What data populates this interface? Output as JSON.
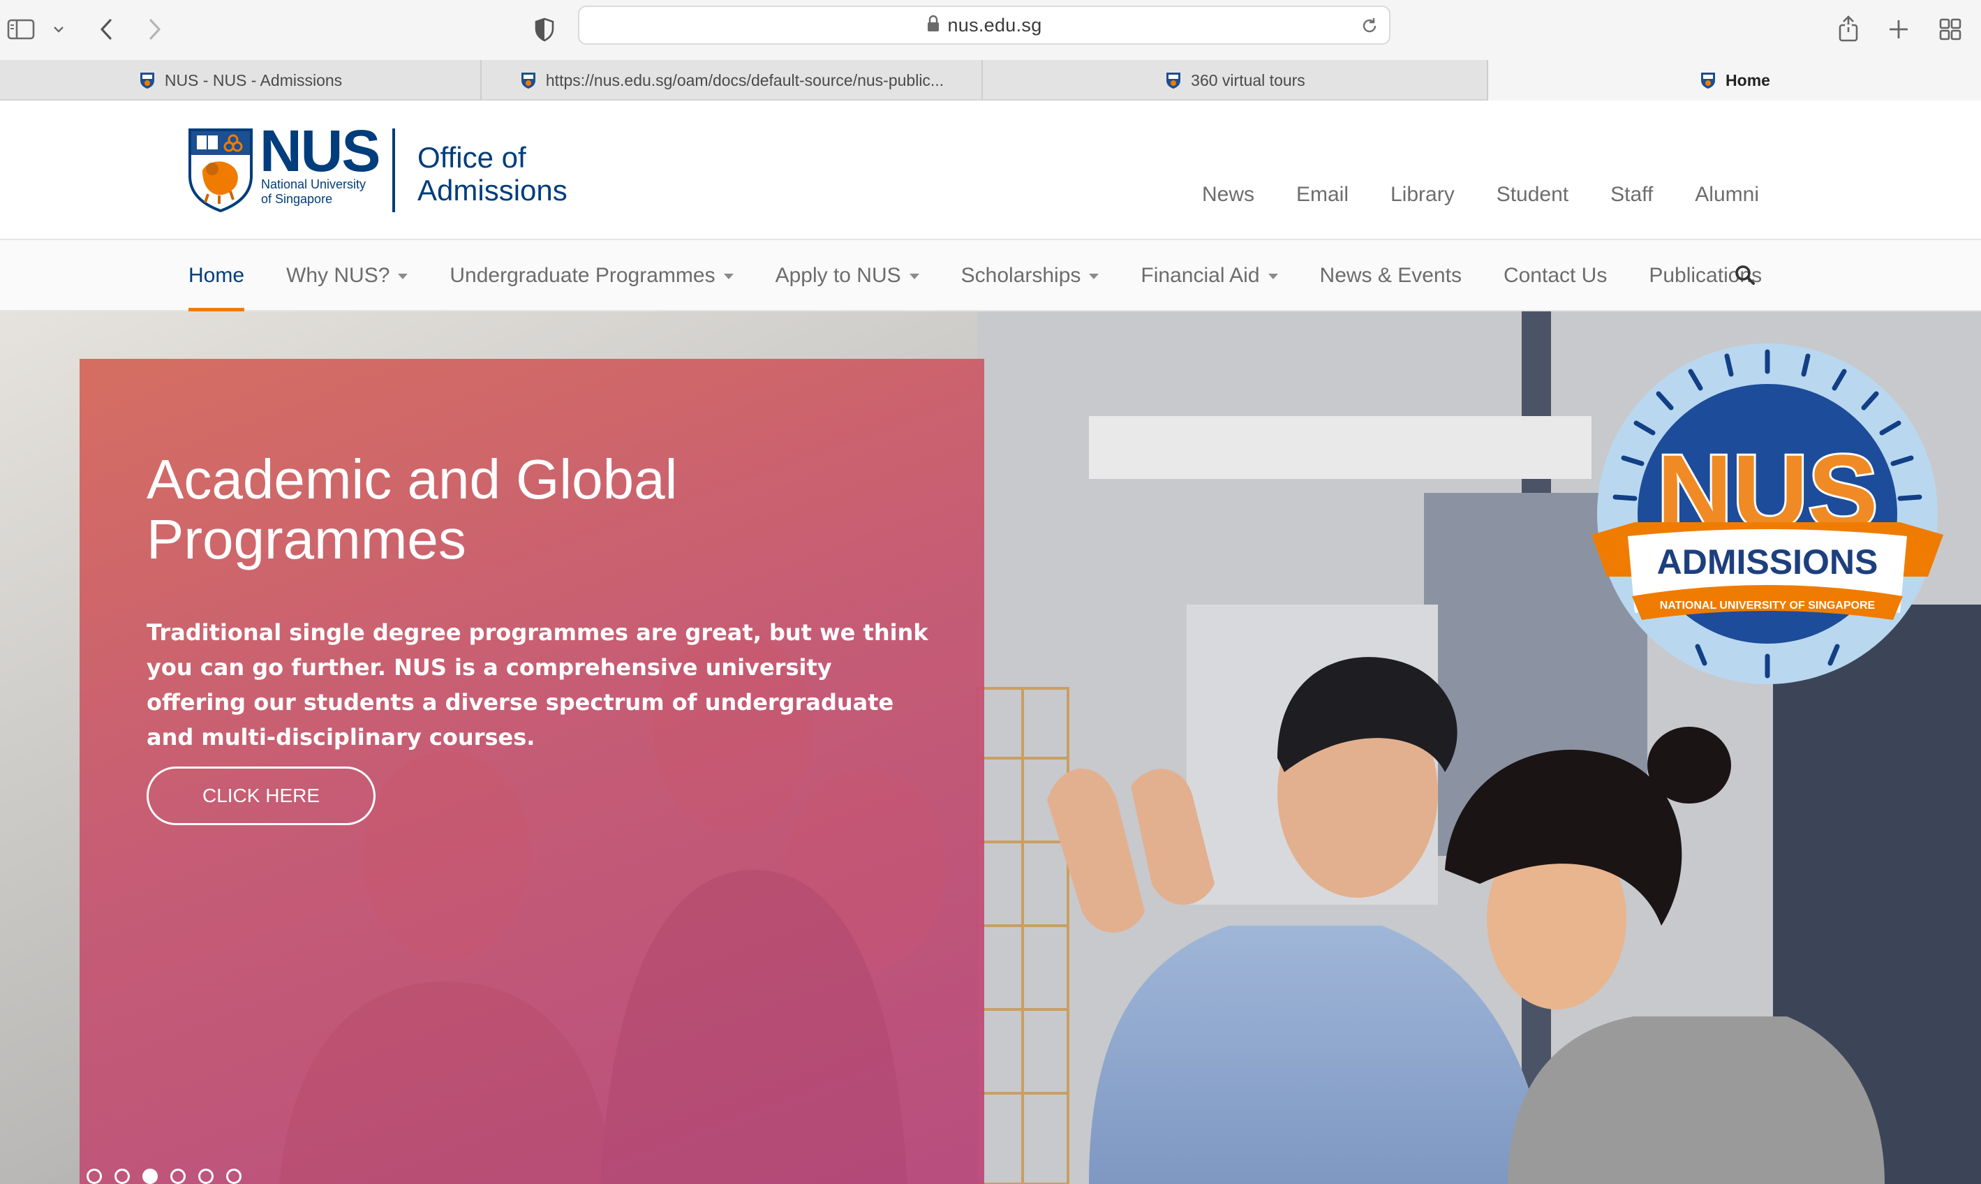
{
  "browser": {
    "url": "nus.edu.sg",
    "tabs": [
      {
        "label": "NUS - NUS - Admissions",
        "active": false
      },
      {
        "label": "https://nus.edu.sg/oam/docs/default-source/nus-public...",
        "active": false
      },
      {
        "label": "360 virtual tours",
        "active": false
      },
      {
        "label": "Home",
        "active": true
      }
    ]
  },
  "header": {
    "logo_word": "NUS",
    "logo_sub_1": "National University",
    "logo_sub_2": "of Singapore",
    "office_1": "Office of",
    "office_2": "Admissions",
    "top_links": [
      "News",
      "Email",
      "Library",
      "Student",
      "Staff",
      "Alumni"
    ]
  },
  "nav": {
    "items": [
      {
        "label": "Home",
        "dropdown": false,
        "active": true
      },
      {
        "label": "Why NUS?",
        "dropdown": true,
        "active": false
      },
      {
        "label": "Undergraduate Programmes",
        "dropdown": true,
        "active": false
      },
      {
        "label": "Apply to NUS",
        "dropdown": true,
        "active": false
      },
      {
        "label": "Scholarships",
        "dropdown": true,
        "active": false
      },
      {
        "label": "Financial Aid",
        "dropdown": true,
        "active": false
      },
      {
        "label": "News & Events",
        "dropdown": false,
        "active": false
      },
      {
        "label": "Contact Us",
        "dropdown": false,
        "active": false
      },
      {
        "label": "Publications",
        "dropdown": false,
        "active": false
      }
    ]
  },
  "hero": {
    "title_line_1": "Academic and Global",
    "title_line_2": "Programmes",
    "text": "Traditional single degree programmes are great, but we think you can go further. NUS is a comprehensive university offering our students a diverse spectrum of undergraduate and multi-disciplinary courses.",
    "button_label": "CLICK HERE",
    "slide_count": 6,
    "active_slide": 3
  },
  "badge": {
    "word": "NUS",
    "ribbon": "ADMISSIONS",
    "ribbon_sub": "NATIONAL UNIVERSITY OF SINGAPORE"
  },
  "colors": {
    "nus_blue": "#003d7c",
    "nus_orange": "#ef7c00",
    "hero_card": "#c65870"
  }
}
